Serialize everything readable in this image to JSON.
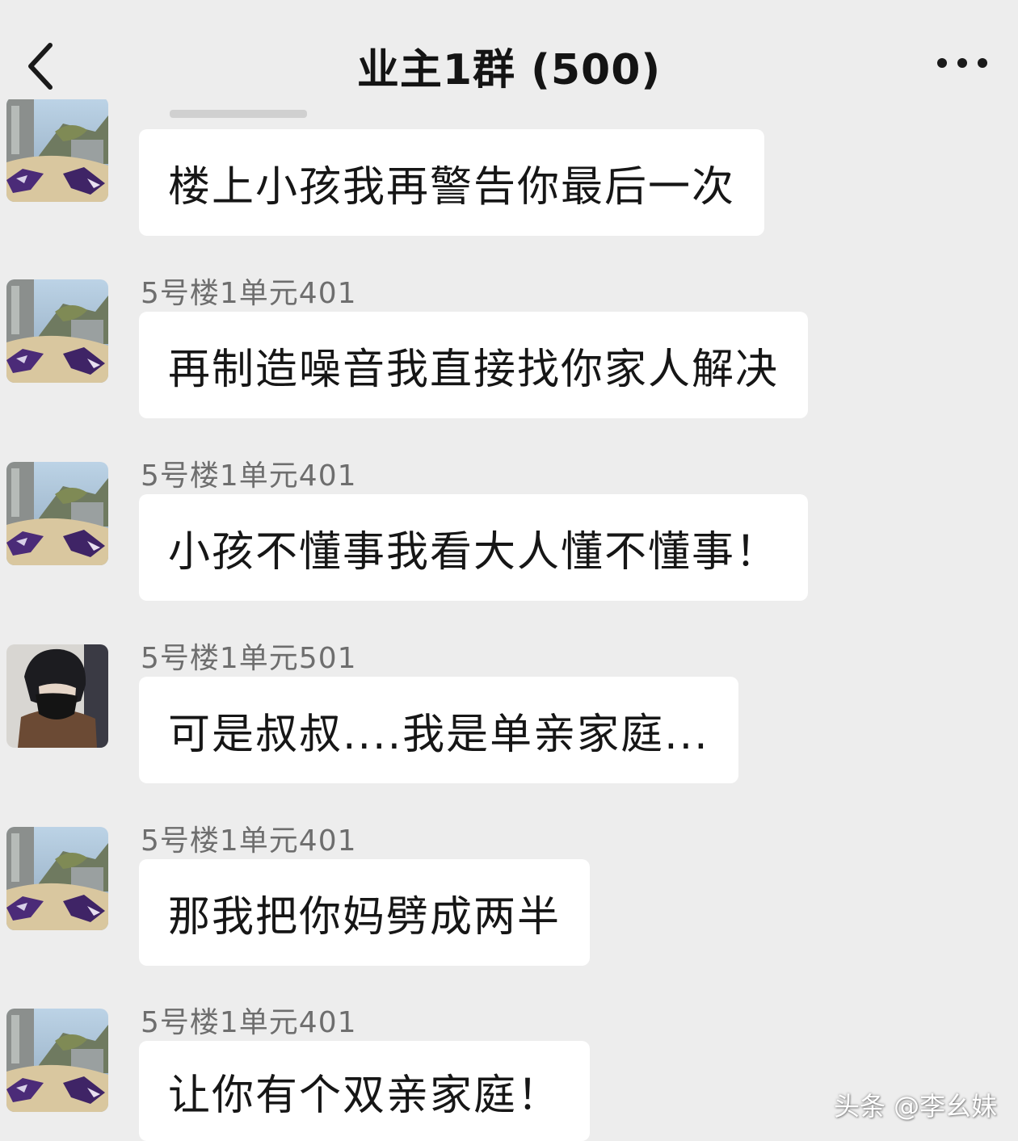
{
  "header": {
    "title": "业主1群 (500)",
    "back_icon": "chevron-left-icon",
    "more_icon": "more-dots-icon"
  },
  "messages": [
    {
      "sender": "",
      "text": "楼上小孩我再警告你最后一次",
      "avatar": "scenery-avatar"
    },
    {
      "sender": "5号楼1单元401",
      "text": "再制造噪音我直接找你家人解决",
      "avatar": "scenery-avatar"
    },
    {
      "sender": "5号楼1单元401",
      "text": "小孩不懂事我看大人懂不懂事！",
      "avatar": "scenery-avatar"
    },
    {
      "sender": "5号楼1单元501",
      "text": "可是叔叔....我是单亲家庭...",
      "avatar": "person-avatar"
    },
    {
      "sender": "5号楼1单元401",
      "text": "那我把你妈劈成两半",
      "avatar": "scenery-avatar"
    },
    {
      "sender": "5号楼1单元401",
      "text": "让你有个双亲家庭！",
      "avatar": "scenery-avatar"
    }
  ],
  "watermark": "头条 @李幺妹",
  "colors": {
    "background": "#ededed",
    "bubble": "#ffffff",
    "sender_text": "#6e6e6e"
  }
}
